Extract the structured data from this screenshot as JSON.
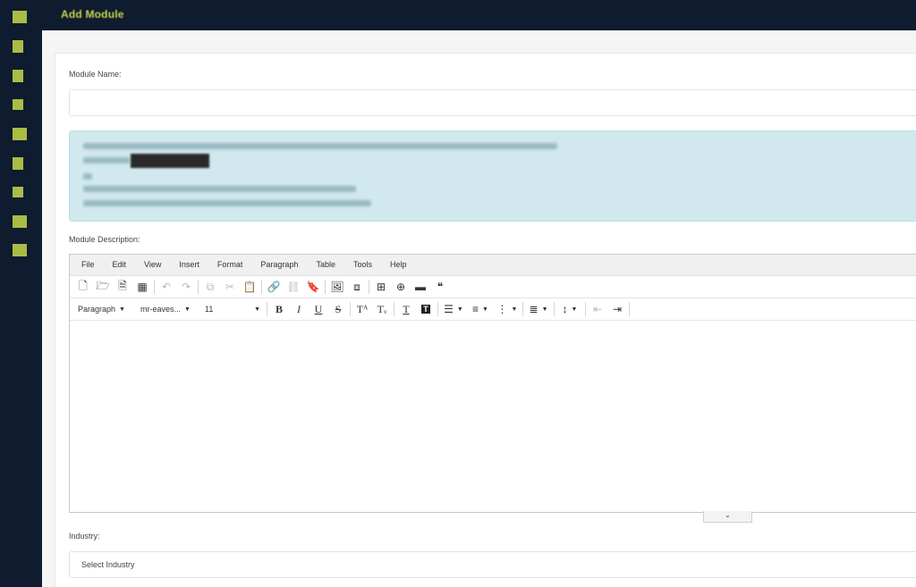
{
  "header": {
    "title": "Add Module"
  },
  "sidebar": {
    "icons": [
      "dashboard-icon",
      "square-icon",
      "document-icon",
      "chart-icon",
      "warning-icon",
      "download-icon",
      "users-icon",
      "folder-icon",
      "briefcase-icon"
    ]
  },
  "form": {
    "module_name_label": "Module Name:",
    "module_name_value": "",
    "module_description_label": "Module Description:",
    "industry_label": "Industry:",
    "industry_value": "Select Industry"
  },
  "editor": {
    "menu": [
      "File",
      "Edit",
      "View",
      "Insert",
      "Format",
      "Paragraph",
      "Table",
      "Tools",
      "Help"
    ],
    "format_block": "Paragraph",
    "font_family": "mr-eaves...",
    "font_size": "11",
    "expand_glyph": "⌄"
  },
  "colors": {
    "dark_navy": "#0f1b2e",
    "accent_lime": "#c5d84a",
    "info_alert_bg": "#d1e9ee"
  }
}
